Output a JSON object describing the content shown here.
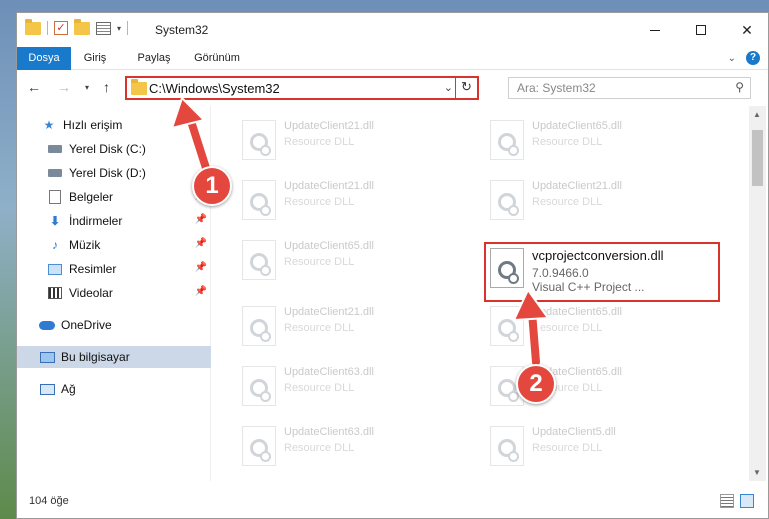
{
  "window": {
    "title": "System32"
  },
  "ribbon": {
    "tabs": [
      "Dosya",
      "Giriş",
      "Paylaş",
      "Görünüm"
    ],
    "help": "?"
  },
  "navbar": {
    "address": "C:\\Windows\\System32",
    "search_placeholder": "Ara: System32"
  },
  "sidebar": {
    "items": [
      {
        "label": "Hızlı erişim",
        "icon": "star-icon"
      },
      {
        "label": "Yerel Disk (C:)",
        "icon": "disk-icon"
      },
      {
        "label": "Yerel Disk (D:)",
        "icon": "disk-icon"
      },
      {
        "label": "Belgeler",
        "icon": "documents-icon",
        "pinned": true
      },
      {
        "label": "İndirmeler",
        "icon": "download-icon",
        "pinned": true
      },
      {
        "label": "Müzik",
        "icon": "music-icon",
        "pinned": true
      },
      {
        "label": "Resimler",
        "icon": "pictures-icon",
        "pinned": true
      },
      {
        "label": "Videolar",
        "icon": "video-icon",
        "pinned": true
      },
      {
        "label": "OneDrive",
        "icon": "cloud-icon"
      },
      {
        "label": "Bu bilgisayar",
        "icon": "computer-icon",
        "selected": true
      },
      {
        "label": "Ağ",
        "icon": "network-icon"
      }
    ]
  },
  "files": [
    {
      "name": "UpdateClient21.dll",
      "desc": "Resource DLL"
    },
    {
      "name": "UpdateClient65.dll",
      "desc": "Resource DLL"
    },
    {
      "name": "UpdateClient21.dll",
      "desc": "Resource DLL"
    },
    {
      "name": "UpdateClient21.dll",
      "desc": "Resource DLL"
    },
    {
      "name": "UpdateClient65.dll",
      "desc": "Resource DLL"
    },
    {
      "name": "vcprojectconversion.dll",
      "version": "7.0.9466.0",
      "desc": "Visual C++ Project ..."
    },
    {
      "name": "UpdateClient21.dll",
      "desc": "Resource DLL"
    },
    {
      "name": "UpdateClient65.dll",
      "desc": "Resource DLL"
    },
    {
      "name": "UpdateClient63.dll",
      "desc": "Resource DLL"
    },
    {
      "name": "UpdateClient65.dll",
      "desc": "Resource DLL"
    },
    {
      "name": "UpdateClient63.dll",
      "desc": "Resource DLL"
    },
    {
      "name": "UpdateClient5.dll",
      "desc": "Resource DLL"
    }
  ],
  "status": {
    "item_count": "104 öğe"
  },
  "annotations": {
    "step1": "1",
    "step2": "2",
    "highlight_color": "#d9342b",
    "callout_color": "#e4473d"
  }
}
